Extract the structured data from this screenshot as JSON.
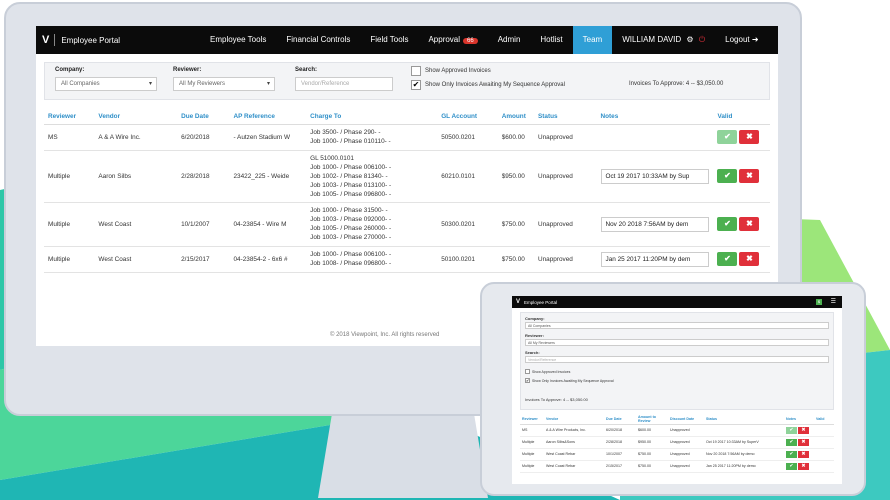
{
  "navbar": {
    "logo_mark": "V",
    "app_title": "Employee Portal",
    "items": [
      "Employee Tools",
      "Financial Controls",
      "Field Tools",
      "Approval",
      "Admin",
      "Hotlist",
      "Team"
    ],
    "approval_badge": "66",
    "user_name": "WILLIAM DAVID",
    "logout_label": "Logout"
  },
  "filters": {
    "company_label": "Company:",
    "company_value": "All Companies",
    "reviewer_label": "Reviewer:",
    "reviewer_value": "All My Reviewers",
    "search_label": "Search:",
    "search_placeholder": "Vendor/Reference",
    "show_approved_label": "Show Approved Invoices",
    "show_sequence_label": "Show Only Invoices Awaiting My Sequence Approval",
    "invoices_to_approve": "Invoices To Approve: 4 -- $3,050.00"
  },
  "table": {
    "headers": [
      "Reviewer",
      "Vendor",
      "Due Date",
      "AP Reference",
      "Charge To",
      "GL Account",
      "Amount",
      "Status",
      "Notes",
      "Valid"
    ],
    "rows": [
      {
        "reviewer": "MS",
        "vendor": "A & A Wire Inc.",
        "due": "6/20/2018",
        "ref": "- Autzen Stadium W",
        "charge": "Job 3500- / Phase 290- -\nJob 1000- / Phase 010110- -",
        "gl": "50500.0201",
        "amount": "$600.00",
        "status": "Unapproved",
        "note": ""
      },
      {
        "reviewer": "Multiple",
        "vendor": "Aaron Silbs",
        "due": "2/28/2018",
        "ref": "23422_225 - Weide",
        "charge": "GL 51000.0101\nJob 1000- / Phase 006100- -\nJob 1002- / Phase 81340- -\nJob 1003- / Phase 013100- -\nJob 1005- / Phase 096800- -",
        "gl": "60210.0101",
        "amount": "$950.00",
        "status": "Unapproved",
        "note": "Oct 19 2017 10:33AM by Sup"
      },
      {
        "reviewer": "Multiple",
        "vendor": "West Coast",
        "due": "10/1/2007",
        "ref": "04-23854 - Wire M",
        "charge": "Job 1000- / Phase 31500- -\nJob 1003- / Phase 092000- -\nJob 1005- / Phase 260000- -\nJob 1003- / Phase 270000- -",
        "gl": "50300.0201",
        "amount": "$750.00",
        "status": "Unapproved",
        "note": "Nov 20 2018 7:56AM by dem"
      },
      {
        "reviewer": "Multiple",
        "vendor": "West Coast",
        "due": "2/15/2017",
        "ref": "04-23854-2 - 6x6 #",
        "charge": "Job 1000- / Phase 006100- -\nJob 1008- / Phase 096800- -",
        "gl": "50100.0201",
        "amount": "$750.00",
        "status": "Unapproved",
        "note": "Jan 25 2017 11:20PM by dem"
      }
    ]
  },
  "footer": "© 2018 Viewpoint, Inc. All rights reserved",
  "tablet": {
    "app_title": "Employee Portal",
    "company_label": "Company:",
    "company_value": "All Companies",
    "reviewer_label": "Reviewer:",
    "reviewer_value": "All My Reviewers",
    "search_label": "Search:",
    "search_placeholder": "Vendor/Reference",
    "show_approved_label": "Show Approved Invoices",
    "show_sequence_label": "Show Only Invoices Awaiting My Sequence Approval",
    "invoices_to_approve": "Invoices To Approve: 4 -- $3,050.00",
    "headers": [
      "Reviewer",
      "Vendor",
      "Due Date",
      "Amount to Review",
      "Discount Date",
      "Status",
      "Notes",
      "Valid"
    ],
    "rows": [
      {
        "reviewer": "MS",
        "vendor": "A & A Wire Products, Inc.",
        "due": "6/20/2018",
        "amount": "$600.00",
        "status": "Unapproved",
        "note": ""
      },
      {
        "reviewer": "Multiple",
        "vendor": "Aaron Silbs&Sons",
        "due": "2/28/2018",
        "amount": "$950.00",
        "status": "Unapproved",
        "note": "Oct 19 2017 10:33AM by SuperV"
      },
      {
        "reviewer": "Multiple",
        "vendor": "West Coast Rebar",
        "due": "10/1/2007",
        "amount": "$750.00",
        "status": "Unapproved",
        "note": "Nov 20 2018 7:56AM by demo"
      },
      {
        "reviewer": "Multiple",
        "vendor": "West Coast Rebar",
        "due": "2/15/2017",
        "amount": "$750.00",
        "status": "Unapproved",
        "note": "Jan 25 2017 11:20PM by demo"
      }
    ]
  },
  "colors": {
    "accent": "#2f9fd6",
    "approve": "#4cb050",
    "reject": "#e0303a",
    "navbar": "#0b0b0b"
  },
  "icons": {
    "approve": "check-icon",
    "reject": "x-icon",
    "logout": "logout-icon",
    "power": "power-icon",
    "gear": "gear-icon"
  }
}
